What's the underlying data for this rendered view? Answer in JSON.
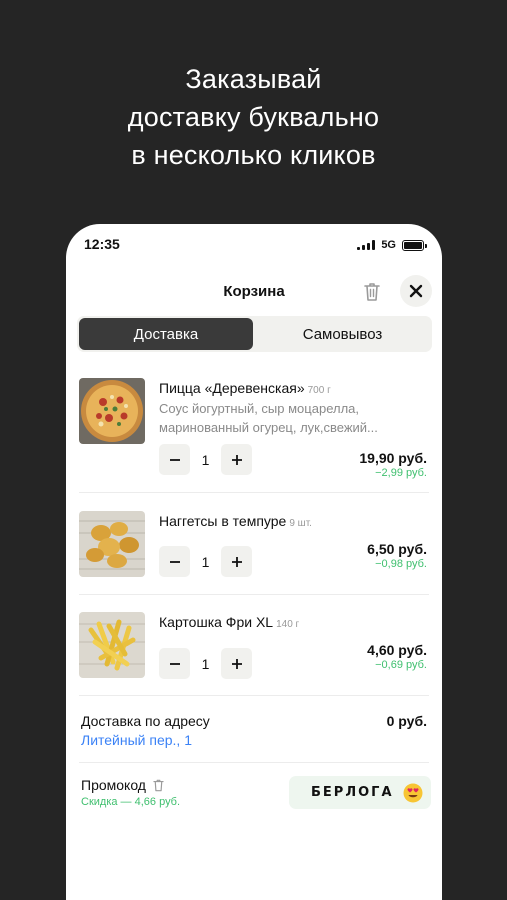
{
  "headline": {
    "line1": "Заказывай",
    "line2": "доставку буквально",
    "line3": "в несколько кликов"
  },
  "status_bar": {
    "time": "12:35",
    "network": "5G"
  },
  "cart": {
    "title": "Корзина",
    "tabs": {
      "delivery": "Доставка",
      "pickup": "Самовывоз",
      "active": "delivery"
    },
    "items": [
      {
        "name": "Пицца «Деревенская»",
        "weight": "700 г",
        "description": "Соус йогуртный, сыр моцарелла, маринованный огурец, лук,свежий...",
        "quantity": "1",
        "price": "19,90 руб.",
        "discount": "−2,99 руб."
      },
      {
        "name": "Наггетсы в темпуре",
        "weight": "9 шт.",
        "description": "",
        "quantity": "1",
        "price": "6,50 руб.",
        "discount": "−0,98 руб."
      },
      {
        "name": "Картошка Фри XL",
        "weight": "140 г",
        "description": "",
        "quantity": "1",
        "price": "4,60 руб.",
        "discount": "−0,69 руб."
      }
    ],
    "delivery": {
      "label": "Доставка по адресу",
      "address": "Литейный пер., 1",
      "cost": "0 руб."
    },
    "promo": {
      "label": "Промокод",
      "discount": "Скидка — 4,66 руб.",
      "code": "БЕРЛОГА"
    }
  },
  "colors": {
    "background": "#252525",
    "accent_green": "#3fbf6e",
    "link_blue": "#3b82f6",
    "segment_active": "#3a3a3a"
  }
}
